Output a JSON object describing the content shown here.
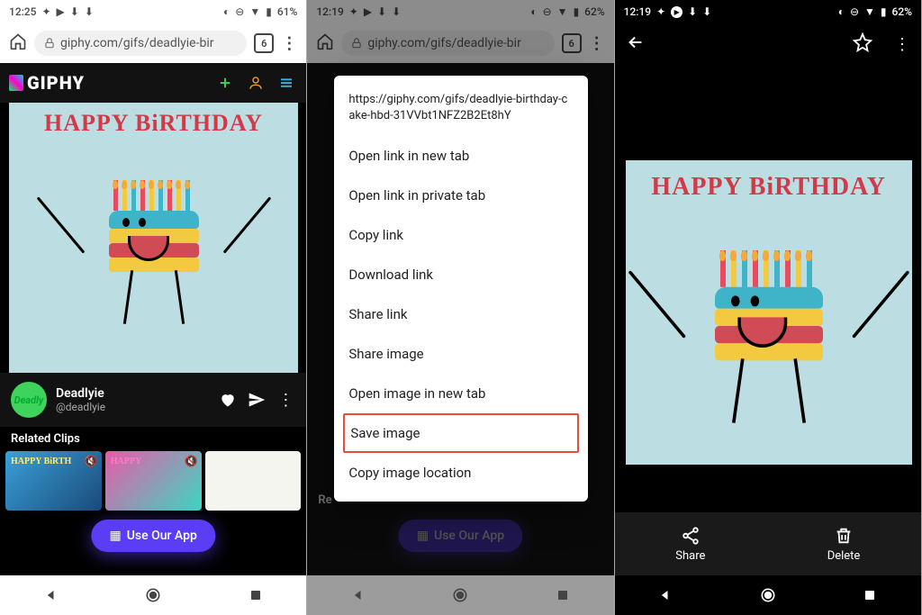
{
  "s1": {
    "status": {
      "time": "12:25",
      "battery": "61%"
    },
    "browser": {
      "url": "giphy.com/gifs/deadlyie-bir",
      "tabs": "6"
    },
    "giphy_logo": "GIPHY",
    "gif_text": "HAPPY BiRTHDAY",
    "author": {
      "name": "Deadlyie",
      "handle": "@deadlyie",
      "avatar": "Deadly"
    },
    "related": "Related Clips",
    "fab": "Use Our App",
    "clip1_text": "HAPPY BiRTH",
    "clip2_text": "HAPPY"
  },
  "s2": {
    "status": {
      "time": "12:19",
      "battery": "62%"
    },
    "browser": {
      "url": "giphy.com/gifs/deadlyie-bir",
      "tabs": "6"
    },
    "menu": {
      "title": "https://giphy.com/gifs/deadlyie-birthday-cake-hbd-31VVbt1NFZ2B2Et8hY",
      "items": [
        "Open link in new tab",
        "Open link in private tab",
        "Copy link",
        "Download link",
        "Share link",
        "Share image",
        "Open image in new tab",
        "Save image",
        "Copy image location"
      ]
    },
    "related": "Re",
    "fab": "Use Our App"
  },
  "s3": {
    "status": {
      "time": "12:19",
      "battery": "62%"
    },
    "gif_text": "HAPPY BiRTHDAY",
    "share": "Share",
    "delete": "Delete"
  }
}
